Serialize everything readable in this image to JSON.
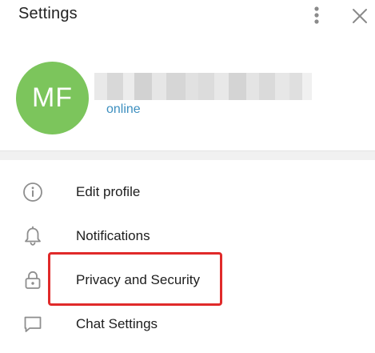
{
  "header": {
    "title": "Settings",
    "menu_icon": "kebab-menu-icon",
    "close_icon": "close-icon"
  },
  "profile": {
    "avatar_initials": "MF",
    "avatar_color": "#7cc55c",
    "status": "online",
    "status_color": "#3d8fbf"
  },
  "menu": {
    "items": [
      {
        "label": "Edit profile",
        "icon": "info-icon"
      },
      {
        "label": "Notifications",
        "icon": "bell-icon"
      },
      {
        "label": "Privacy and Security",
        "icon": "lock-icon"
      },
      {
        "label": "Chat Settings",
        "icon": "chat-bubble-icon"
      }
    ]
  },
  "highlight_color": "#e02a2a"
}
